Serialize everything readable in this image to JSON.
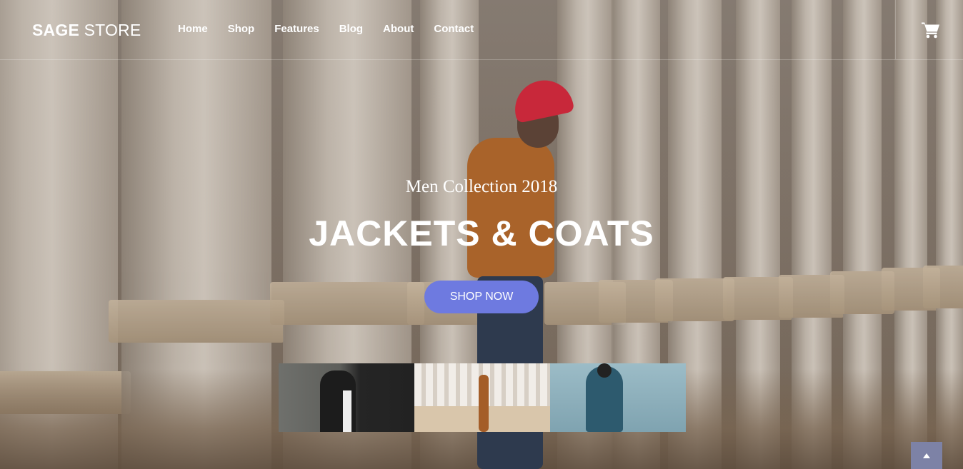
{
  "header": {
    "logo_bold": "SAGE",
    "logo_rest": " STORE",
    "nav": [
      "Home",
      "Shop",
      "Features",
      "Blog",
      "About",
      "Contact"
    ],
    "cart_icon": "shopping-cart-icon"
  },
  "hero": {
    "subtitle": "Men Collection 2018",
    "title": "JACKETS & COATS",
    "button_label": "SHOP NOW",
    "button_color": "#6e7ae0"
  },
  "thumbnails": [
    "thumbnail-woman-jacket",
    "thumbnail-man-columns",
    "thumbnail-man-backpack"
  ],
  "back_to_top_icon": "chevron-up-icon"
}
